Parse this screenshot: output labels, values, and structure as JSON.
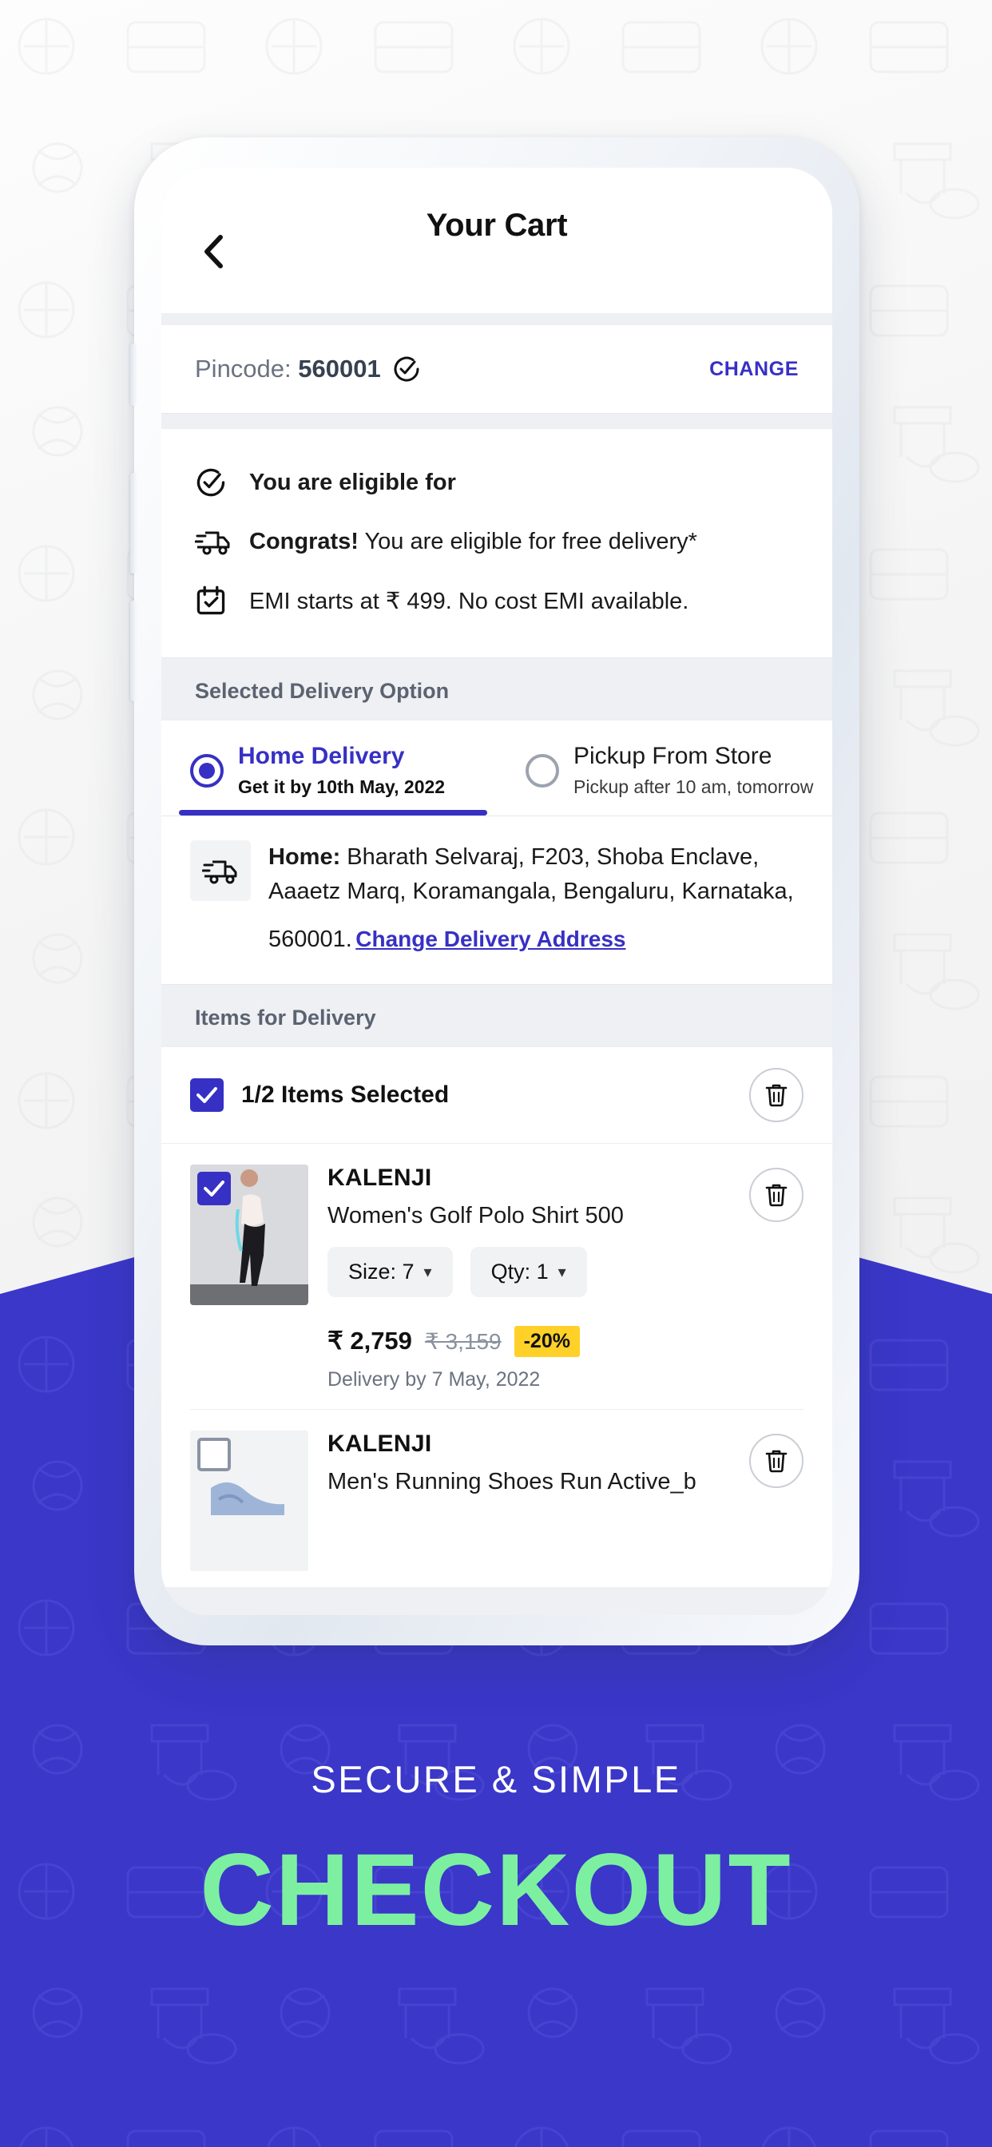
{
  "colors": {
    "brand_blue": "#3730c4",
    "hero_bg": "#3a37c9",
    "hero_accent": "#7cf0a0",
    "discount_badge": "#ffd028"
  },
  "app": {
    "header": {
      "title": "Your Cart",
      "back_icon": "chevron-left-icon"
    },
    "pincode": {
      "label": "Pincode:",
      "value": "560001",
      "verified_icon": "check-circle-icon",
      "change_label": "CHANGE"
    },
    "eligibility": {
      "rows": [
        {
          "icon": "check-circle-icon",
          "bold": "You are eligible for",
          "rest": ""
        },
        {
          "icon": "delivery-truck-icon",
          "bold": "Congrats!",
          "rest": " You are eligible for free delivery*"
        },
        {
          "icon": "calendar-check-icon",
          "bold": "",
          "rest": "EMI starts at ₹ 499. No cost EMI available."
        }
      ]
    },
    "delivery": {
      "section_label": "Selected Delivery Option",
      "options": [
        {
          "title": "Home Delivery",
          "subtitle": "Get it by 10th May, 2022",
          "selected": true
        },
        {
          "title": "Pickup From Store",
          "subtitle": "Pickup after 10 am, tomorrow",
          "selected": false
        }
      ],
      "address": {
        "icon": "delivery-truck-icon",
        "label": "Home:",
        "text": " Bharath Selvaraj, F203, Shoba Enclave, Aaaetz Marq, Koramangala, Bengaluru, Karnataka, 560001.",
        "change_link": "Change Delivery Address"
      }
    },
    "items": {
      "section_label": "Items for Delivery",
      "select_all": {
        "label": "1/2 Items Selected",
        "checked": true,
        "delete_icon": "trash-icon"
      },
      "list": [
        {
          "checked": true,
          "brand": "KALENJI",
          "name": "Women's Golf Polo Shirt 500",
          "size_label": "Size: 7",
          "qty_label": "Qty: 1",
          "price_now": "₹ 2,759",
          "price_was": "₹ 3,159",
          "discount": "-20%",
          "eta": "Delivery by 7 May, 2022",
          "delete_icon": "trash-icon"
        },
        {
          "checked": false,
          "brand": "KALENJI",
          "name": "Men's Running Shoes Run Active_b",
          "delete_icon": "trash-icon"
        }
      ]
    }
  },
  "hero": {
    "kicker": "SECURE & SIMPLE",
    "title": "CHECKOUT"
  }
}
